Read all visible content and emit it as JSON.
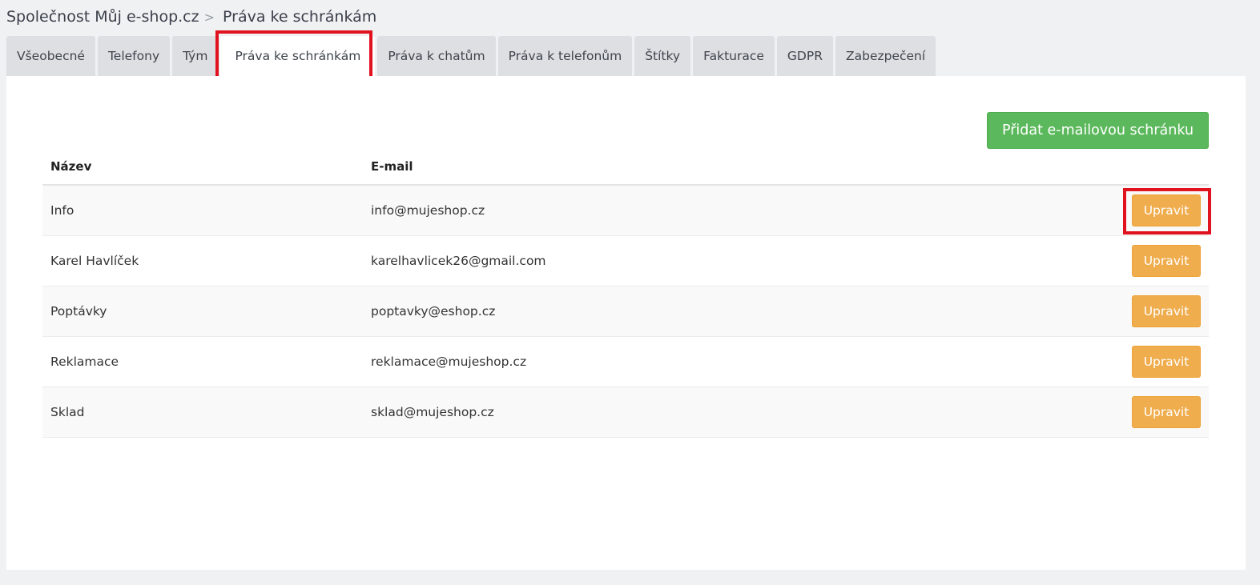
{
  "breadcrumb": {
    "company": "Společnost Můj e-shop.cz",
    "separator": ">",
    "current": "Práva ke schránkám"
  },
  "tabs": [
    {
      "label": "Všeobecné",
      "active": false
    },
    {
      "label": "Telefony",
      "active": false
    },
    {
      "label": "Tým",
      "active": false
    },
    {
      "label": "Práva ke schránkám",
      "active": true
    },
    {
      "label": "Práva k chatům",
      "active": false
    },
    {
      "label": "Práva k telefonům",
      "active": false
    },
    {
      "label": "Štítky",
      "active": false
    },
    {
      "label": "Fakturace",
      "active": false
    },
    {
      "label": "GDPR",
      "active": false
    },
    {
      "label": "Zabezpečení",
      "active": false
    }
  ],
  "actions": {
    "add_mailbox_label": "Přidat e-mailovou schránku"
  },
  "table": {
    "headers": {
      "name": "Název",
      "email": "E-mail"
    },
    "rows": [
      {
        "name": "Info",
        "email": "info@mujeshop.cz",
        "action": "Upravit"
      },
      {
        "name": "Karel Havlíček",
        "email": "karelhavlicek26@gmail.com",
        "action": "Upravit"
      },
      {
        "name": "Poptávky",
        "email": "poptavky@eshop.cz",
        "action": "Upravit"
      },
      {
        "name": "Reklamace",
        "email": "reklamace@mujeshop.cz",
        "action": "Upravit"
      },
      {
        "name": "Sklad",
        "email": "sklad@mujeshop.cz",
        "action": "Upravit"
      }
    ]
  },
  "colors": {
    "add_button": "#5cb85c",
    "edit_button": "#f0ad4e",
    "highlight": "#e0121f"
  }
}
